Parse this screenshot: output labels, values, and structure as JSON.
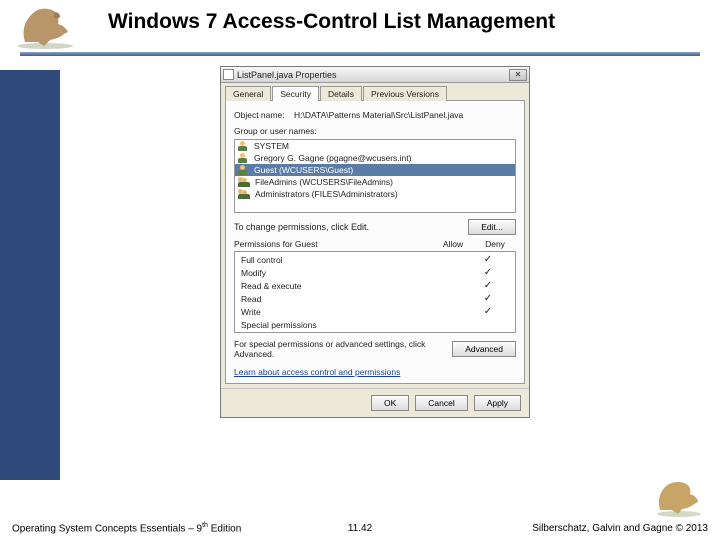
{
  "slide": {
    "title": "Windows 7 Access-Control List Management"
  },
  "dialog": {
    "windowTitle": "ListPanel.java Properties",
    "tabs": [
      "General",
      "Security",
      "Details",
      "Previous Versions"
    ],
    "activeTab": 1,
    "objectLabel": "Object name:",
    "objectPath": "H:\\DATA\\Patterns Material\\Src\\ListPanel.java",
    "groupLabel": "Group or user names:",
    "users": [
      {
        "name": "SYSTEM",
        "type": "user"
      },
      {
        "name": "Gregory G. Gagne (pgagne@wcusers.int)",
        "type": "user"
      },
      {
        "name": "Guest (WCUSERS\\Guest)",
        "type": "user"
      },
      {
        "name": "FileAdmins (WCUSERS\\FileAdmins)",
        "type": "group"
      },
      {
        "name": "Administrators (FILES\\Administrators)",
        "type": "group"
      }
    ],
    "selectedUser": 2,
    "changeText": "To change permissions, click Edit.",
    "editBtn": "Edit...",
    "permHeader": "Permissions for Guest",
    "colAllow": "Allow",
    "colDeny": "Deny",
    "permissions": [
      {
        "name": "Full control",
        "allow": false,
        "deny": true
      },
      {
        "name": "Modify",
        "allow": false,
        "deny": true
      },
      {
        "name": "Read & execute",
        "allow": false,
        "deny": true
      },
      {
        "name": "Read",
        "allow": false,
        "deny": true
      },
      {
        "name": "Write",
        "allow": false,
        "deny": true
      },
      {
        "name": "Special permissions",
        "allow": false,
        "deny": false
      }
    ],
    "advText": "For special permissions or advanced settings, click Advanced.",
    "advBtn": "Advanced",
    "learnLink": "Learn about access control and permissions",
    "okBtn": "OK",
    "cancelBtn": "Cancel",
    "applyBtn": "Apply"
  },
  "footer": {
    "left": "Operating System Concepts Essentials – 9",
    "leftSup": "th",
    "leftTail": " Edition",
    "pageNum": "11.42",
    "right": "Silberschatz, Galvin and Gagne © 2013"
  }
}
